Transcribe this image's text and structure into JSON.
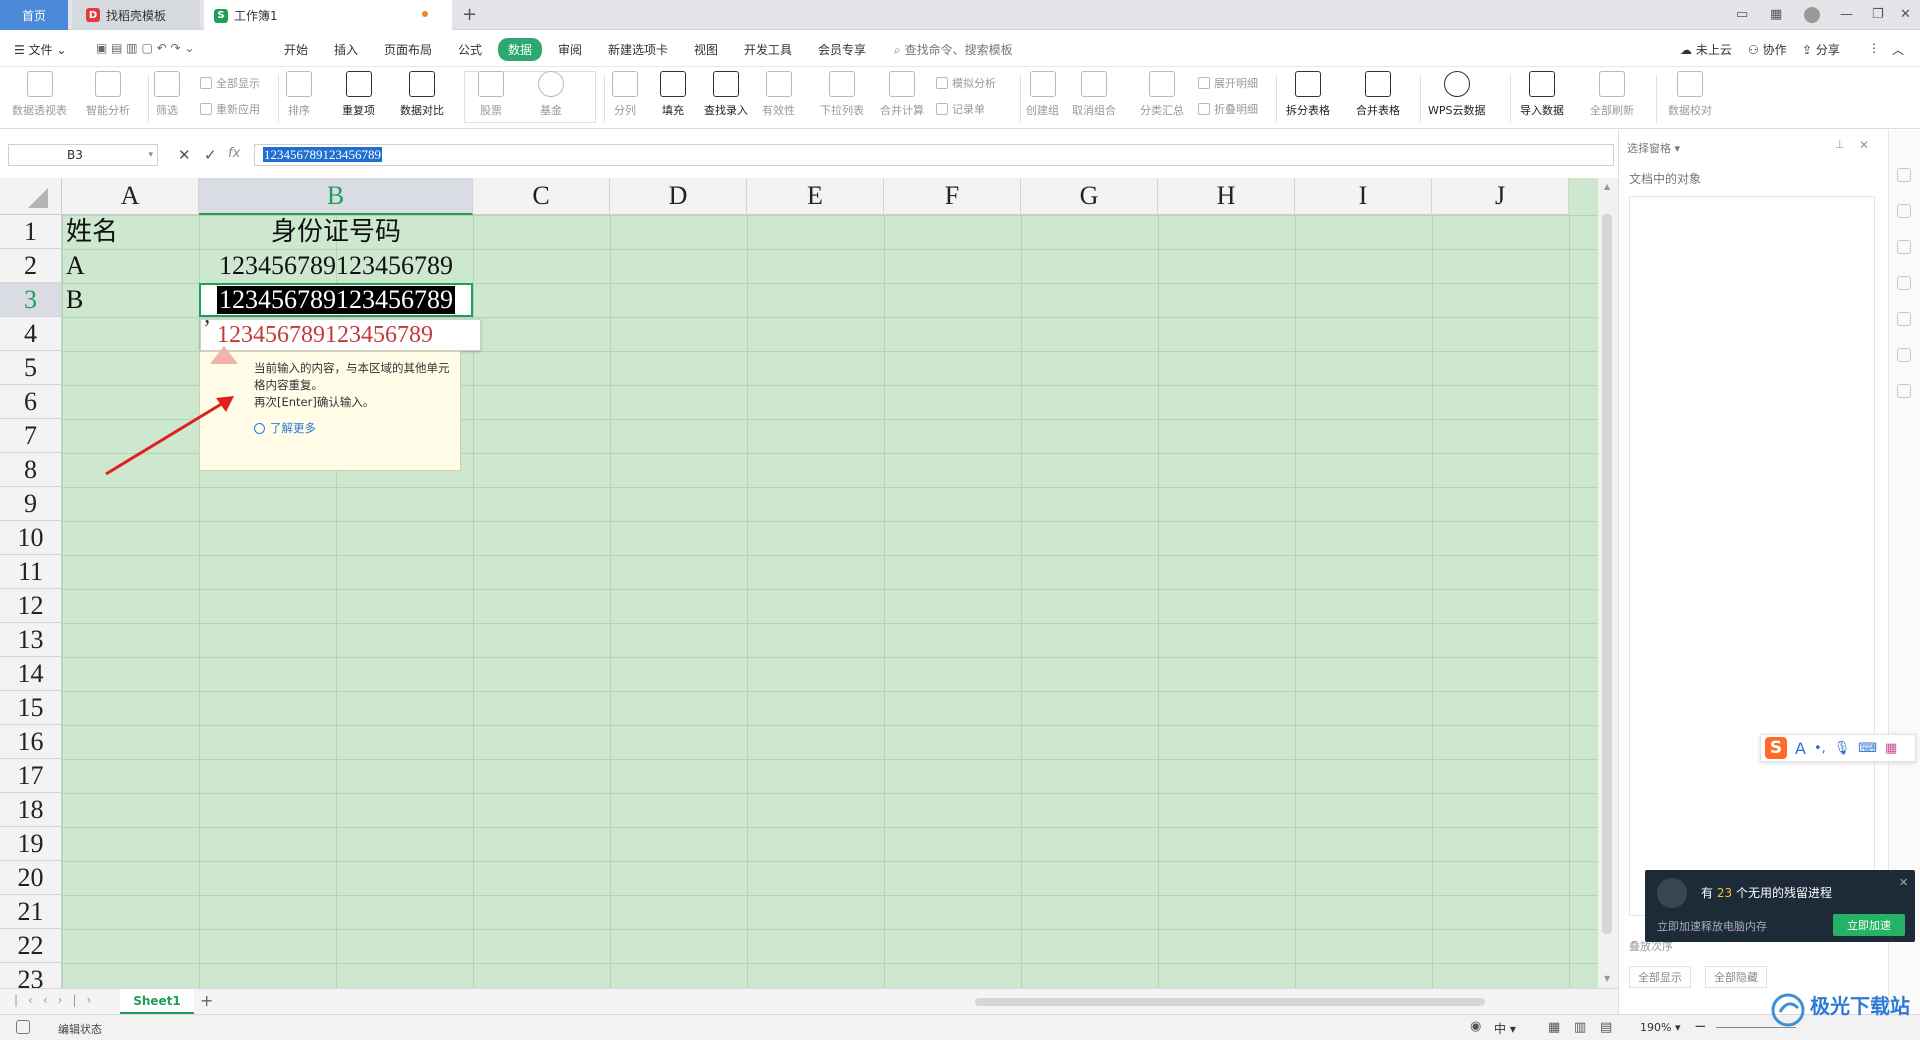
{
  "tabs": {
    "home": "首页",
    "template": "找稻壳模板",
    "workbook": "工作簿1",
    "add": "+"
  },
  "menu": {
    "file": "文件",
    "items": [
      "开始",
      "插入",
      "页面布局",
      "公式",
      "数据",
      "审阅",
      "新建选项卡",
      "视图",
      "开发工具",
      "会员专享"
    ],
    "search": "查找命令、搜索模板",
    "cloud": "未上云",
    "collab": "协作",
    "share": "分享"
  },
  "ribbon": {
    "pivot": "数据透视表",
    "smart": "智能分析",
    "filter": "筛选",
    "show_all": "全部显示",
    "reapply": "重新应用",
    "sort": "排序",
    "dup": "重复项",
    "compare": "数据对比",
    "stock": "股票",
    "fund": "基金",
    "split": "分列",
    "fill": "填充",
    "find_entry": "查找录入",
    "validity": "有效性",
    "dropdown": "下拉列表",
    "merge_calc": "合并计算",
    "simulate": "模拟分析",
    "record": "记录单",
    "create_group": "创建组",
    "ungroup": "取消组合",
    "subtotal": "分类汇总",
    "expand": "展开明细",
    "collapse": "折叠明细",
    "split_table": "拆分表格",
    "merge_table": "合并表格",
    "cloud_data": "WPS云数据",
    "import": "导入数据",
    "refresh_all": "全部刷新",
    "verify": "数据校对"
  },
  "formula": {
    "cell_ref": "B3",
    "fx": "fx",
    "value": "123456789123456789"
  },
  "grid": {
    "columns": [
      "A",
      "B",
      "C",
      "D",
      "E",
      "F",
      "G",
      "H",
      "I",
      "J"
    ],
    "rows": [
      "1",
      "2",
      "3",
      "4",
      "5",
      "6",
      "7",
      "8",
      "9",
      "10",
      "11",
      "12",
      "13",
      "14",
      "15",
      "16",
      "17",
      "18",
      "19",
      "20",
      "21",
      "22",
      "23"
    ],
    "a1": "姓名",
    "b1": "身份证号码",
    "a2": "A",
    "b2": "123456789123456789",
    "a3": "B",
    "b3": "123456789123456789"
  },
  "suggestion": "123456789123456789",
  "warning": {
    "line1": "当前输入的内容，与本区域的其他单元格内容重复。",
    "line2": "再次[Enter]确认输入。",
    "link": "了解更多"
  },
  "sheets": {
    "active": "Sheet1",
    "add": "+"
  },
  "status": {
    "mode": "编辑状态",
    "zoom": "190%",
    "lang": "中"
  },
  "panel": {
    "title": "选择窗格",
    "objects": "文档中的对象",
    "show_all": "全部显示",
    "hide_all": "全部隐藏",
    "order": "叠放次序"
  },
  "notification": {
    "prefix": "有",
    "count": "23",
    "suffix": "个无用的残留进程",
    "sub": "立即加速释放电脑内存",
    "button": "立即加速"
  },
  "watermark": "极光下载站"
}
